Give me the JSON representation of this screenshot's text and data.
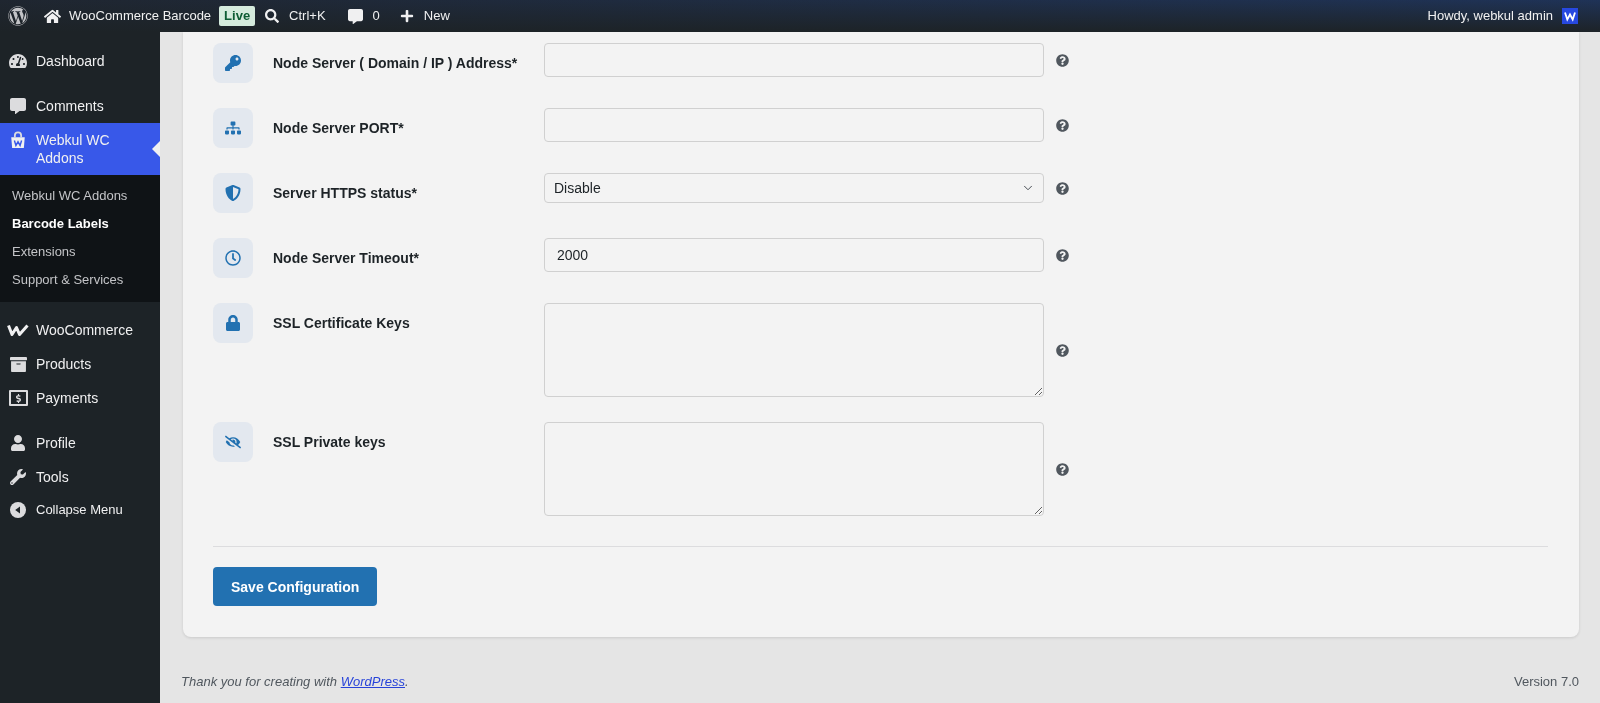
{
  "admin_bar": {
    "site_name": "WooCommerce Barcode",
    "environment_badge": "Live",
    "search_shortcut": "Ctrl+K",
    "comment_count": "0",
    "new_label": "New",
    "greeting": "Howdy, webkul admin"
  },
  "sidebar": {
    "groups": [
      {
        "items": [
          {
            "label": "Dashboard",
            "selected": false
          }
        ]
      },
      {
        "items": [
          {
            "label": "Comments",
            "selected": false
          },
          {
            "label": "Webkul WC Addons",
            "selected": true,
            "children": [
              {
                "label": "Webkul WC Addons",
                "selected": false
              },
              {
                "label": "Barcode Labels",
                "selected": true
              },
              {
                "label": "Extensions",
                "selected": false
              },
              {
                "label": "Support & Services",
                "selected": false
              }
            ]
          }
        ]
      },
      {
        "items": [
          {
            "label": "WooCommerce",
            "selected": false
          },
          {
            "label": "Products",
            "selected": false
          },
          {
            "label": "Payments",
            "selected": false
          }
        ]
      },
      {
        "items": [
          {
            "label": "Profile",
            "selected": false
          },
          {
            "label": "Tools",
            "selected": false
          }
        ]
      }
    ],
    "collapse_label": "Collapse Menu"
  },
  "settings_form": {
    "fields": [
      {
        "label": "Node Server ( Domain / IP ) Address*",
        "kind": "text"
      },
      {
        "label": "Node Server PORT*",
        "kind": "text"
      },
      {
        "label": "Server HTTPS status*",
        "kind": "select",
        "value": "Disable"
      },
      {
        "label": "Node Server Timeout*",
        "kind": "text",
        "value": "2000"
      },
      {
        "label": "SSL Certificate Keys",
        "kind": "textarea"
      },
      {
        "label": "SSL Private keys",
        "kind": "textarea"
      }
    ],
    "submit_label": "Save Configuration"
  },
  "footer": {
    "credit_text": "Thank you for creating with",
    "credit_link": "WordPress",
    "credit_end": ".",
    "version": "Version 7.0"
  }
}
